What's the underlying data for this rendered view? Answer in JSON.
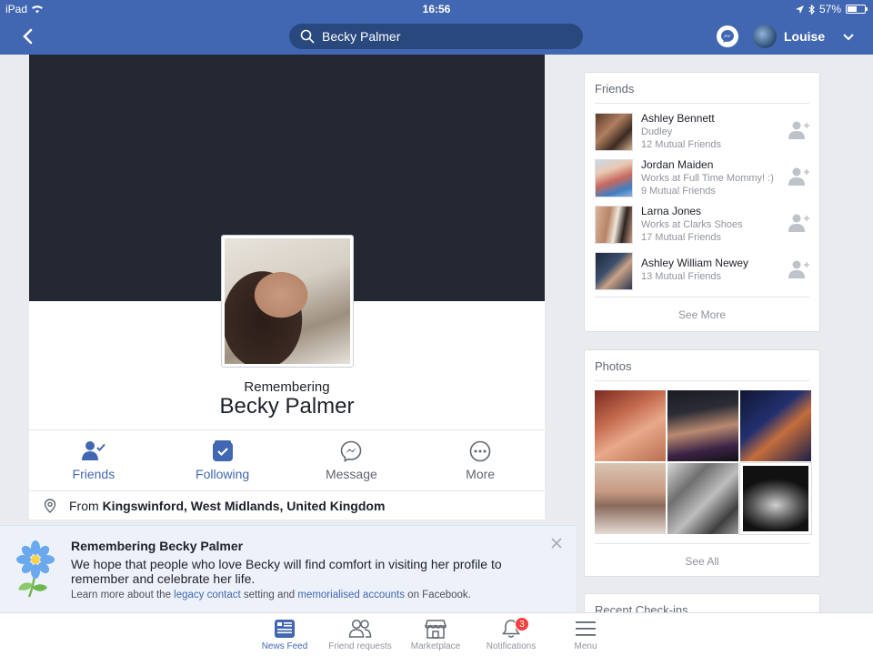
{
  "status_bar": {
    "carrier": "iPad",
    "time": "16:56",
    "battery": "57%",
    "battery_level": 0.57
  },
  "nav": {
    "search_value": "Becky Palmer",
    "user_name": "Louise"
  },
  "profile": {
    "remembering_label": "Remembering",
    "name": "Becky Palmer",
    "actions": [
      {
        "label": "Friends"
      },
      {
        "label": "Following"
      },
      {
        "label": "Message"
      },
      {
        "label": "More"
      }
    ],
    "from_prefix": "From",
    "from_place": "Kingswinford, West Midlands, United Kingdom"
  },
  "friends_card": {
    "title": "Friends",
    "items": [
      {
        "name": "Ashley Bennett",
        "line1": "Dudley",
        "line2": "12 Mutual Friends"
      },
      {
        "name": "Jordan Maiden",
        "line1": "Works at Full Time Mommy! :)",
        "line2": "9 Mutual Friends"
      },
      {
        "name": "Larna Jones",
        "line1": "Works at Clarks Shoes",
        "line2": "17 Mutual Friends"
      },
      {
        "name": "Ashley William Newey",
        "line1": "13 Mutual Friends"
      }
    ],
    "see_more": "See More"
  },
  "photos_card": {
    "title": "Photos",
    "see_all": "See All"
  },
  "checkins_card": {
    "title": "Recent Check-ins"
  },
  "memorial_banner": {
    "title": "Remembering Becky Palmer",
    "body": "We hope that people who love Becky will find comfort in visiting her profile to remember and celebrate her life.",
    "learn_prefix": "Learn more about the",
    "legacy_link": "legacy contact",
    "learn_middle": "setting and",
    "memorialised_link": "memorialised accounts",
    "learn_suffix": "on Facebook."
  },
  "tabbar": {
    "tabs": [
      {
        "label": "News Feed"
      },
      {
        "label": "Friend requests"
      },
      {
        "label": "Marketplace"
      },
      {
        "label": "Notifications",
        "badge": "3"
      },
      {
        "label": "Menu"
      }
    ]
  },
  "colors": {
    "brand": "#4267b2",
    "cover": "#232833",
    "badge": "#fa3e3e"
  }
}
